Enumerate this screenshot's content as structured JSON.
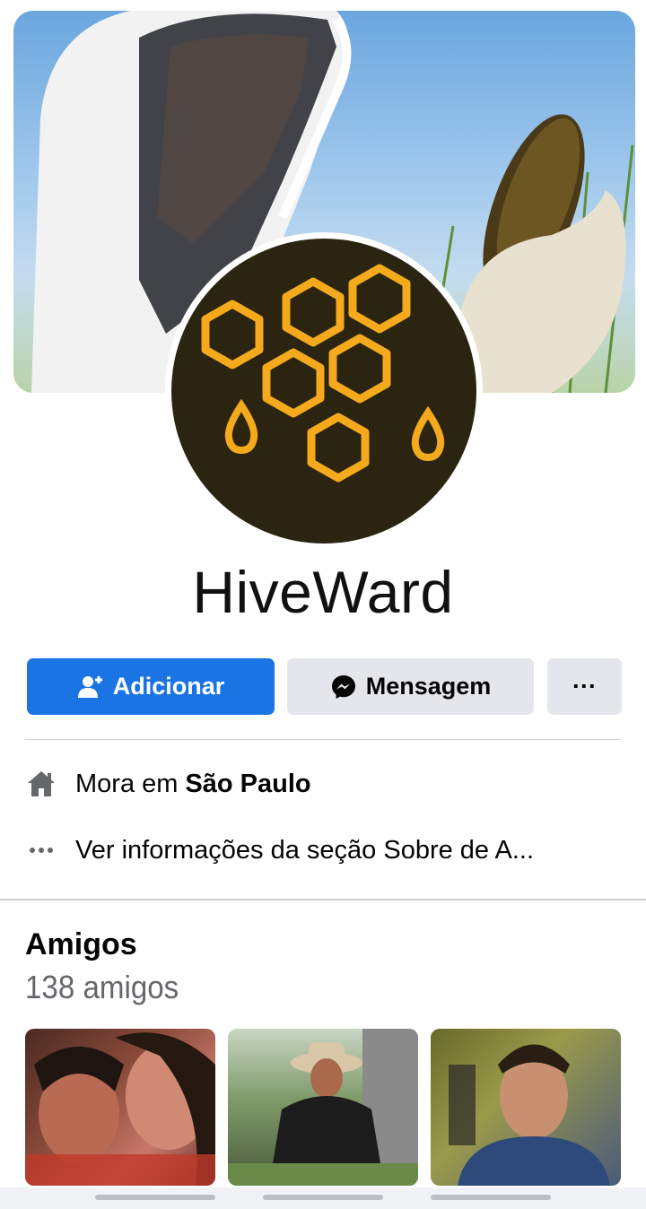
{
  "profile": {
    "name": "HiveWard"
  },
  "actions": {
    "add_label": "Adicionar",
    "message_label": "Mensagem",
    "more_label": "···"
  },
  "info": {
    "home_prefix": "Mora em",
    "home_city": "São Paulo",
    "about_text": "Ver informações da seção Sobre de A..."
  },
  "friends": {
    "title": "Amigos",
    "count_text": "138 amigos"
  },
  "icons": {
    "add": "add-friend-icon",
    "message": "messenger-icon",
    "home": "home-icon",
    "more": "more-dots-icon"
  },
  "colors": {
    "primary": "#1b74e4",
    "secondary_button": "#e4e6eb",
    "muted_text": "#65676b",
    "honey": "#f5a91c",
    "avatar_bg": "#2a2410"
  }
}
